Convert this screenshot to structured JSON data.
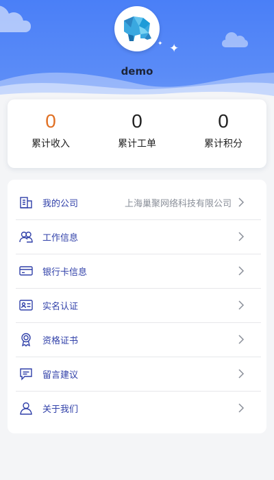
{
  "profile": {
    "username": "demo"
  },
  "stats": [
    {
      "value": "0",
      "label": "累计收入"
    },
    {
      "value": "0",
      "label": "累计工单"
    },
    {
      "value": "0",
      "label": "累计积分"
    }
  ],
  "menu": [
    {
      "icon": "building-icon",
      "label": "我的公司",
      "value": "上海巢聚网络科技有限公司"
    },
    {
      "icon": "people-icon",
      "label": "工作信息",
      "value": ""
    },
    {
      "icon": "bank-card-icon",
      "label": "银行卡信息",
      "value": ""
    },
    {
      "icon": "id-card-icon",
      "label": "实名认证",
      "value": ""
    },
    {
      "icon": "certificate-icon",
      "label": "资格证书",
      "value": ""
    },
    {
      "icon": "message-icon",
      "label": "留言建议",
      "value": ""
    },
    {
      "icon": "user-icon",
      "label": "关于我们",
      "value": ""
    }
  ],
  "colors": {
    "header_blue": "#4a7ff7",
    "accent_orange": "#e07024",
    "menu_text": "#2f3fa8"
  }
}
